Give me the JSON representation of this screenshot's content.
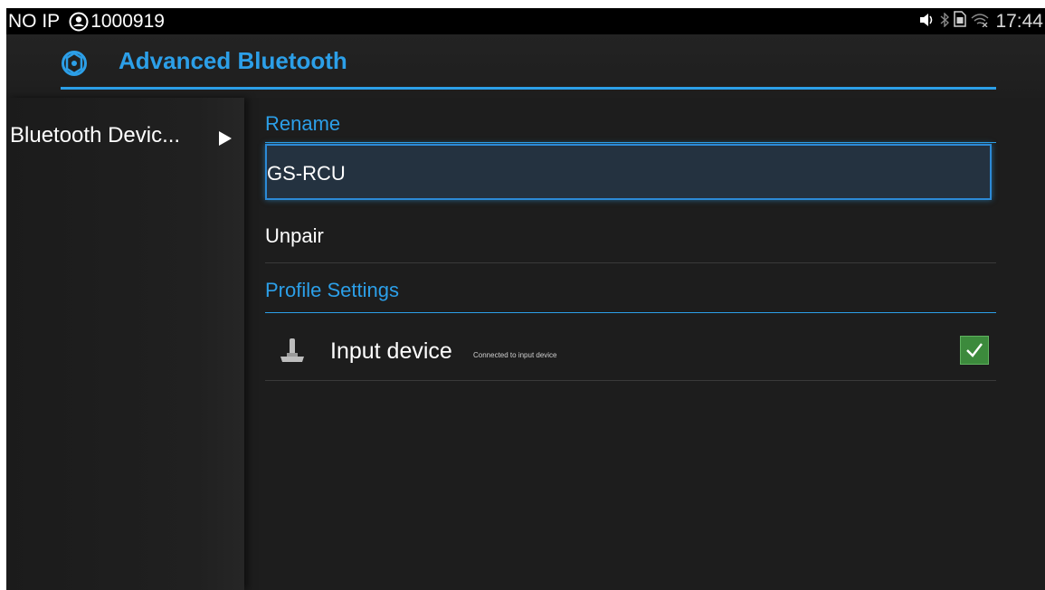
{
  "status_bar": {
    "ip_text": "NO IP",
    "account_number": "1000919",
    "time": "17:44",
    "icons": [
      "account-icon",
      "volume-icon",
      "bluetooth-icon",
      "sim-icon",
      "wifi-icon"
    ]
  },
  "header": {
    "title": "Advanced Bluetooth",
    "icon": "settings-globe-icon",
    "accent_color": "#2c9fe8"
  },
  "nav": {
    "items": [
      {
        "label": "Bluetooth Devic...",
        "icon": "play-arrow-icon",
        "selected": true
      }
    ]
  },
  "content": {
    "rename_header": "Rename",
    "rename_value": "GS-RCU",
    "unpair_label": "Unpair",
    "profile_header": "Profile Settings",
    "profiles": [
      {
        "title": "Input device",
        "subtitle": "Connected to input device",
        "icon": "joystick-icon",
        "checked": true
      }
    ]
  },
  "colors": {
    "background": "#1d1d1d",
    "accent": "#2c9fe8",
    "checkbox": "#3c8a3c"
  }
}
